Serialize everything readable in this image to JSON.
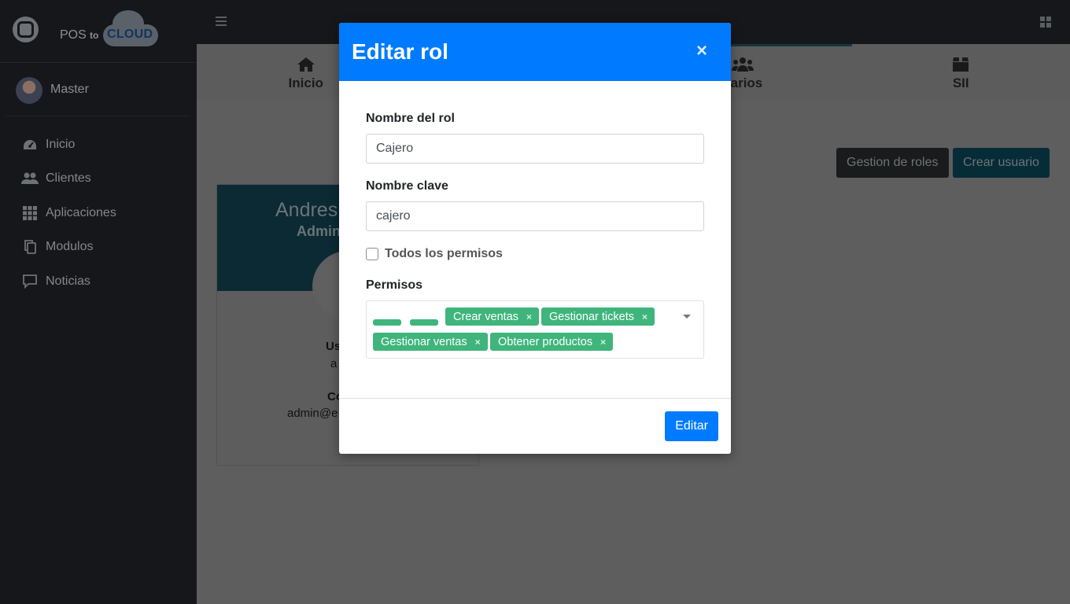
{
  "brand": {
    "text": "POS",
    "to": "to",
    "cloud": "CLOUD"
  },
  "user": {
    "name": "Master"
  },
  "sidebar": {
    "items": [
      {
        "label": "Inicio",
        "icon": "dashboard-gauge-icon"
      },
      {
        "label": "Clientes",
        "icon": "users-icon"
      },
      {
        "label": "Aplicaciones",
        "icon": "grid-apps-icon"
      },
      {
        "label": "Modulos",
        "icon": "copy-files-icon"
      },
      {
        "label": "Noticias",
        "icon": "comment-icon"
      }
    ]
  },
  "tabs": [
    {
      "label": "Inicio",
      "icon": "home-icon"
    },
    {
      "label": "",
      "icon": ""
    },
    {
      "label": "uarios",
      "icon": "users-group-icon"
    },
    {
      "label": "SII",
      "icon": "box-icon"
    }
  ],
  "actions": {
    "roles_label": "Gestion de roles",
    "create_label": "Crear usuario"
  },
  "card": {
    "name": "Andres",
    "role": "Admin",
    "user_label": "Us",
    "user_value": "a",
    "contact_label": "Co",
    "contact_value": "admin@e"
  },
  "modal": {
    "title": "Editar rol",
    "close_symbol": "×",
    "role_name_label": "Nombre del rol",
    "role_name_value": "Cajero",
    "key_name_label": "Nombre clave",
    "key_name_value": "cajero",
    "all_permissions_label": "Todos los permisos",
    "all_permissions_checked": false,
    "permissions_label": "Permisos",
    "permissions": [
      {
        "label": "Crear ventas"
      },
      {
        "label": "Gestionar tickets"
      },
      {
        "label": "Gestionar ventas"
      },
      {
        "label": "Obtener productos"
      }
    ],
    "tag_remove_symbol": "×",
    "submit_label": "Editar"
  },
  "colors": {
    "primary": "#007bff",
    "tag": "#3fb57c",
    "sidebar_bg": "#15171a",
    "overlay_bg": "#5e5e5e"
  }
}
